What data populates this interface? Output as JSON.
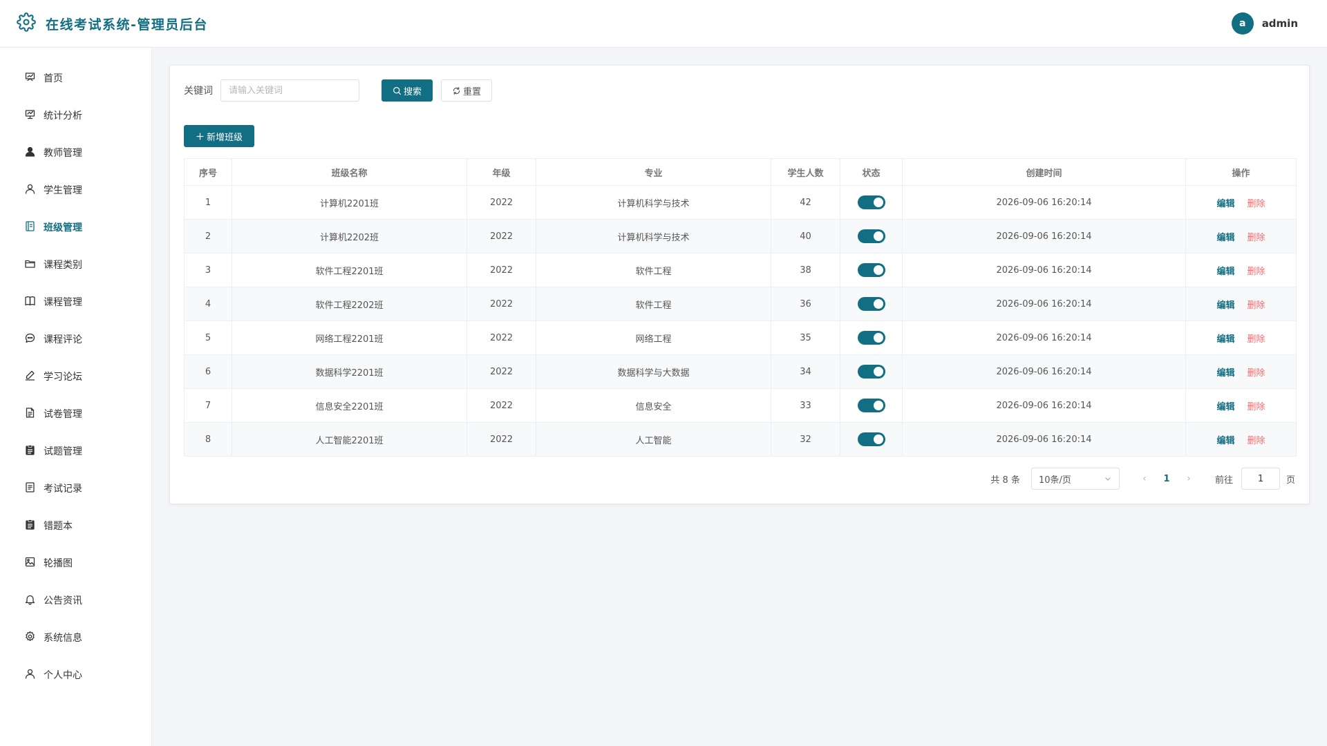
{
  "header": {
    "title": "在线考试系统-管理员后台",
    "avatar_letter": "a",
    "username": "admin"
  },
  "sidebar": {
    "active_index": 4,
    "items": [
      {
        "label": "首页",
        "icon": "home-icon"
      },
      {
        "label": "统计分析",
        "icon": "chart-icon"
      },
      {
        "label": "教师管理",
        "icon": "user-filled-icon"
      },
      {
        "label": "学生管理",
        "icon": "user-icon"
      },
      {
        "label": "班级管理",
        "icon": "notebook-icon"
      },
      {
        "label": "课程类别",
        "icon": "folder-icon"
      },
      {
        "label": "课程管理",
        "icon": "book-icon"
      },
      {
        "label": "课程评论",
        "icon": "chat-icon"
      },
      {
        "label": "学习论坛",
        "icon": "pen-icon"
      },
      {
        "label": "试卷管理",
        "icon": "document-icon"
      },
      {
        "label": "试题管理",
        "icon": "clipboard-icon"
      },
      {
        "label": "考试记录",
        "icon": "tickets-icon"
      },
      {
        "label": "错题本",
        "icon": "clipboard-icon"
      },
      {
        "label": "轮播图",
        "icon": "picture-icon"
      },
      {
        "label": "公告资讯",
        "icon": "bell-icon"
      },
      {
        "label": "系统信息",
        "icon": "gear-icon"
      },
      {
        "label": "个人中心",
        "icon": "user-icon"
      }
    ]
  },
  "search": {
    "label": "关键词",
    "placeholder": "请输入关键词",
    "value": "",
    "search_button": "搜索",
    "reset_button": "重置"
  },
  "toolbar": {
    "add_button": "新增班级"
  },
  "table": {
    "columns": [
      "序号",
      "班级名称",
      "年级",
      "专业",
      "学生人数",
      "状态",
      "创建时间",
      "操作"
    ],
    "edit_label": "编辑",
    "delete_label": "删除",
    "rows": [
      {
        "no": "1",
        "name": "计算机2201班",
        "grade": "2022",
        "major": "计算机科学与技术",
        "count": "42",
        "enabled": true,
        "created": "2026-09-06 16:20:14"
      },
      {
        "no": "2",
        "name": "计算机2202班",
        "grade": "2022",
        "major": "计算机科学与技术",
        "count": "40",
        "enabled": true,
        "created": "2026-09-06 16:20:14"
      },
      {
        "no": "3",
        "name": "软件工程2201班",
        "grade": "2022",
        "major": "软件工程",
        "count": "38",
        "enabled": true,
        "created": "2026-09-06 16:20:14"
      },
      {
        "no": "4",
        "name": "软件工程2202班",
        "grade": "2022",
        "major": "软件工程",
        "count": "36",
        "enabled": true,
        "created": "2026-09-06 16:20:14"
      },
      {
        "no": "5",
        "name": "网络工程2201班",
        "grade": "2022",
        "major": "网络工程",
        "count": "35",
        "enabled": true,
        "created": "2026-09-06 16:20:14"
      },
      {
        "no": "6",
        "name": "数据科学2201班",
        "grade": "2022",
        "major": "数据科学与大数据",
        "count": "34",
        "enabled": true,
        "created": "2026-09-06 16:20:14"
      },
      {
        "no": "7",
        "name": "信息安全2201班",
        "grade": "2022",
        "major": "信息安全",
        "count": "33",
        "enabled": true,
        "created": "2026-09-06 16:20:14"
      },
      {
        "no": "8",
        "name": "人工智能2201班",
        "grade": "2022",
        "major": "人工智能",
        "count": "32",
        "enabled": true,
        "created": "2026-09-06 16:20:14"
      }
    ]
  },
  "pagination": {
    "total_text": "共 8 条",
    "page_size": "10条/页",
    "current_page": "1",
    "goto_label": "前往",
    "goto_value": "1",
    "goto_unit": "页"
  },
  "colors": {
    "primary": "#126e82",
    "danger": "#f56c6c"
  }
}
